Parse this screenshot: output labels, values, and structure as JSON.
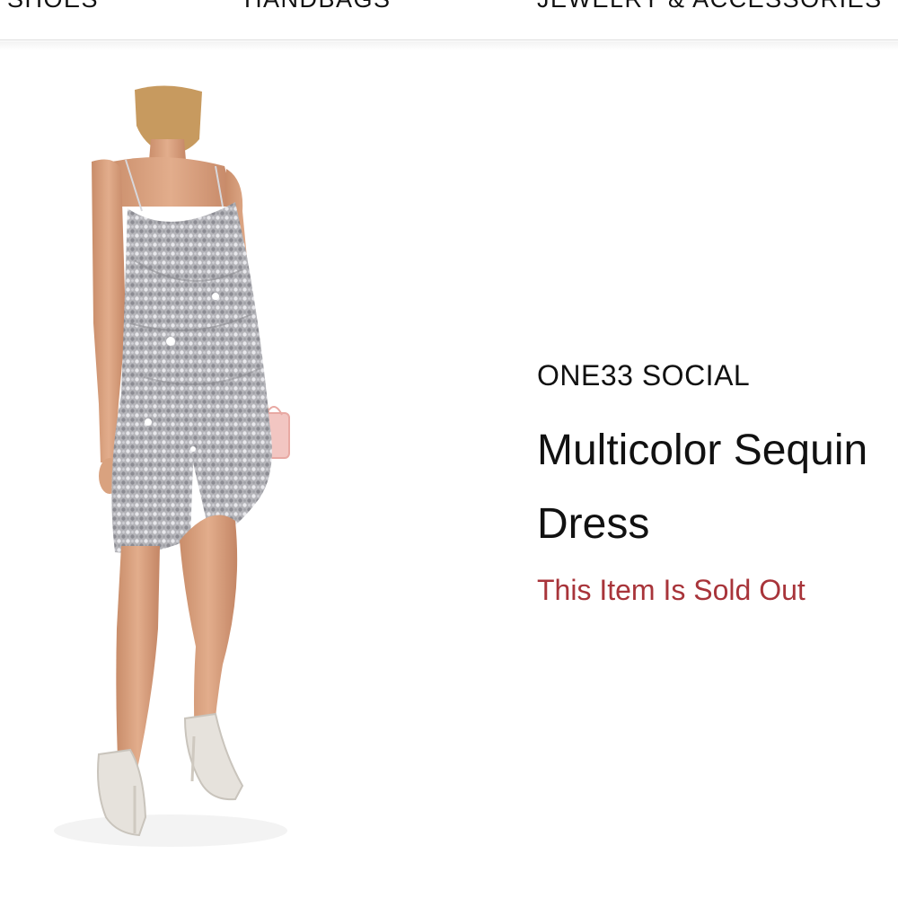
{
  "nav": {
    "items": [
      {
        "label": "SHOES"
      },
      {
        "label": "HANDBAGS"
      },
      {
        "label": "JEWELRY & ACCESSORIES"
      }
    ]
  },
  "product": {
    "brand": "ONE33 SOCIAL",
    "name_line1": "Multicolor Sequin",
    "name_line2": "Dress",
    "status": "This Item Is Sold Out",
    "image": {
      "subject": "model-wearing-sequin-wrap-dress",
      "dress_color": "#b9b9bd",
      "skin_color": "#d9a27f",
      "hair_color": "#c79a5f",
      "bag_color": "#f2c6c2",
      "shoe_color": "#e6e2dc"
    }
  },
  "colors": {
    "sold_out": "#a8343a",
    "text": "#111111",
    "divider": "#dcdcdc"
  }
}
